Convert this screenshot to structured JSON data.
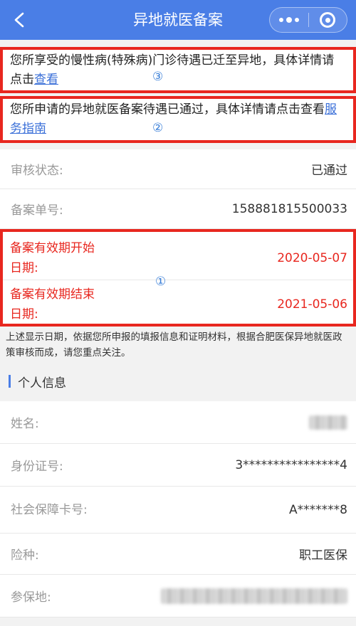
{
  "nav": {
    "title": "异地就医备案"
  },
  "notices": {
    "chronic": {
      "text": "您所享受的慢性病(特殊病)门诊待遇已迁至异地，具体详情请点击",
      "link": "查看",
      "marker": "③"
    },
    "approved": {
      "text": "您所申请的异地就医备案待遇已通过，具体详情请点击查看",
      "link": "服务指南",
      "marker": "②"
    }
  },
  "record": {
    "status_label": "审核状态:",
    "status_value": "已通过",
    "number_label": "备案单号:",
    "number_value": "158881815500033"
  },
  "validity": {
    "marker": "①",
    "start_label": "备案有效期开始日期:",
    "start_value": "2020-05-07",
    "end_label": "备案有效期结束日期:",
    "end_value": "2021-05-06"
  },
  "hint": "上述显示日期，依据您所申报的填报信息和证明材料，根据合肥医保异地就医政策审核而成，请您重点关注。",
  "personal": {
    "section_title": "个人信息",
    "name_label": "姓名:",
    "id_label": "身份证号:",
    "id_value": "3****************4",
    "card_label": "社会保障卡号:",
    "card_value": "A*******8",
    "insurance_label": "险种:",
    "insurance_value": "职工医保",
    "location_label": "参保地:"
  },
  "colors": {
    "nav_bg": "#4a7ee6",
    "highlight_red": "#e8271f",
    "link_blue": "#3a6fd8"
  },
  "icons": {
    "back": "chevron-left-icon",
    "more": "more-dots-icon",
    "close": "target-circle-icon"
  }
}
